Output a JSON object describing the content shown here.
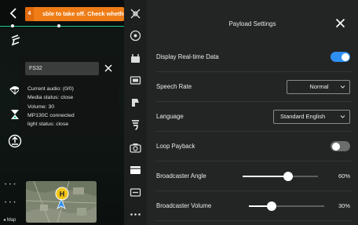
{
  "alert": {
    "count": "4",
    "message": "sble to take off. Check whether t"
  },
  "fs_panel": {
    "device_name": "FS32",
    "lines": [
      "Current audio: (0/0)",
      "Media status: close",
      "Volume: 30",
      "MP130C connected",
      "light status: close"
    ]
  },
  "map": {
    "label": "Map",
    "home_marker": "H"
  },
  "panel": {
    "title": "Payload Settings",
    "display_realtime": {
      "label": "Display Real-time Data",
      "on": true
    },
    "speech_rate": {
      "label": "Speech Rate",
      "value": "Normal"
    },
    "language": {
      "label": "Language",
      "value": "Standard English"
    },
    "loop_payback": {
      "label": "Loop Payback",
      "on": false
    },
    "broadcaster_angle": {
      "label": "Broadcaster Angle",
      "percent": 60,
      "value_text": "60%"
    },
    "broadcaster_volume": {
      "label": "Broadcaster Volume",
      "percent": 30,
      "value_text": "30%"
    }
  },
  "colors": {
    "accent_blue": "#2e8ff0",
    "alert_orange": "#ef7d17",
    "status_green": "#1fc98a",
    "toggle_off": "#6b6c6c"
  },
  "icons": {
    "left_column": [
      "back-icon",
      "flight-path-icon",
      "parachute-icon",
      "hourglass-icon",
      "upload-icon"
    ],
    "toolbar": [
      "gimbal-icon",
      "target-icon",
      "payload-icon",
      "camera-box-icon",
      "spotlight-icon",
      "speaker-icon",
      "camera-icon",
      "video-icon",
      "card-icon",
      "more-icon"
    ]
  }
}
